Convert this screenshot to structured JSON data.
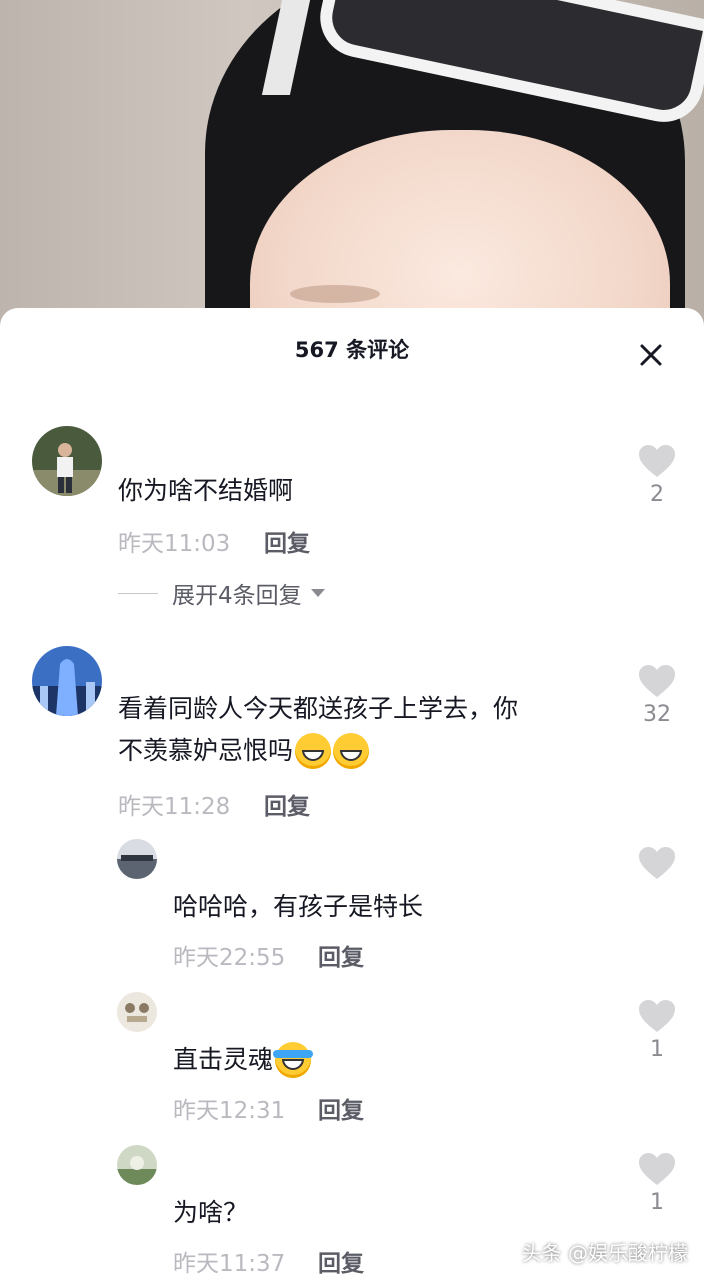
{
  "header": {
    "title": "567 条评论"
  },
  "comments": [
    {
      "text": "你为啥不结婚啊",
      "time": "昨天11:03",
      "reply_label": "回复",
      "likes": "2",
      "expand_label": "展开4条回复"
    },
    {
      "text_line1": "看着同龄人今天都送孩子上学去，你",
      "text_line2": "不羡慕妒忌恨吗",
      "time": "昨天11:28",
      "reply_label": "回复",
      "likes": "32"
    }
  ],
  "replies": [
    {
      "text": "哈哈哈，有孩子是特长",
      "time": "昨天22:55",
      "reply_label": "回复",
      "likes": ""
    },
    {
      "text": "直击灵魂",
      "time": "昨天12:31",
      "reply_label": "回复",
      "likes": "1"
    },
    {
      "text": "为啥？",
      "time": "昨天11:37",
      "reply_label": "回复",
      "likes": "1"
    }
  ],
  "watermark": "头条 @娱乐酸柠檬",
  "colors": {
    "primary_text": "#161823",
    "meta_text": "#b9bac0",
    "like_icon": "#d5d5d8"
  }
}
